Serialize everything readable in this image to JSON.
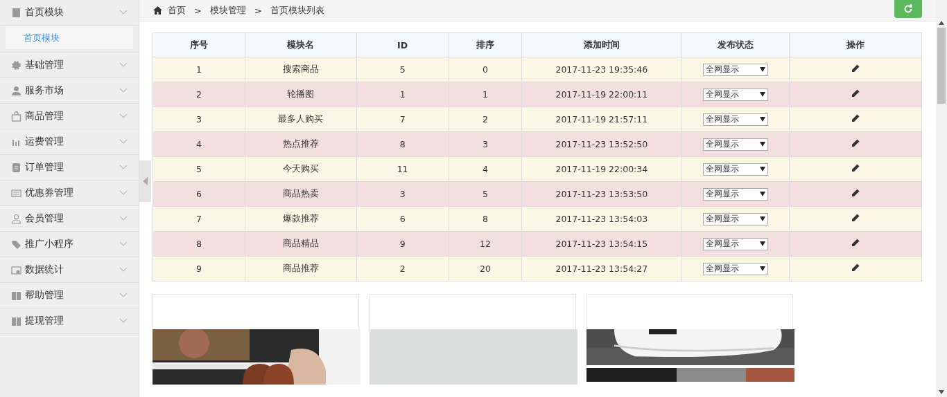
{
  "sidebar": {
    "items": [
      {
        "label": "首页模块",
        "children": [
          {
            "label": "首页模块",
            "selected": true
          }
        ]
      },
      {
        "label": "基础管理"
      },
      {
        "label": "服务市场"
      },
      {
        "label": "商品管理"
      },
      {
        "label": "运费管理"
      },
      {
        "label": "订单管理"
      },
      {
        "label": "优惠券管理"
      },
      {
        "label": "会员管理"
      },
      {
        "label": "推广小程序"
      },
      {
        "label": "数据统计"
      },
      {
        "label": "帮助管理"
      },
      {
        "label": "提现管理"
      }
    ]
  },
  "breadcrumb": [
    "首页",
    "模块管理",
    "首页模块列表"
  ],
  "breadcrumb_separator": ">",
  "table": {
    "columns": [
      "序号",
      "模块名",
      "ID",
      "排序",
      "添加时间",
      "发布状态",
      "操作"
    ],
    "rows": [
      {
        "cells": [
          "1",
          "搜索商品",
          "5",
          "0",
          "2017-11-23 19:35:46"
        ],
        "status": "全网显示"
      },
      {
        "cells": [
          "2",
          "轮播图",
          "1",
          "1",
          "2017-11-19 22:00:11"
        ],
        "status": "全网显示"
      },
      {
        "cells": [
          "3",
          "最多人购买",
          "7",
          "2",
          "2017-11-19 21:57:11"
        ],
        "status": "全网显示"
      },
      {
        "cells": [
          "4",
          "热点推荐",
          "8",
          "3",
          "2017-11-23 13:52:50"
        ],
        "status": "全网显示"
      },
      {
        "cells": [
          "5",
          "今天购买",
          "11",
          "4",
          "2017-11-19 22:00:34"
        ],
        "status": "全网显示"
      },
      {
        "cells": [
          "6",
          "商品热卖",
          "3",
          "5",
          "2017-11-23 13:53:50"
        ],
        "status": "全网显示"
      },
      {
        "cells": [
          "7",
          "爆款推荐",
          "6",
          "8",
          "2017-11-23 13:54:03"
        ],
        "status": "全网显示"
      },
      {
        "cells": [
          "8",
          "商品精品",
          "9",
          "12",
          "2017-11-23 13:54:15"
        ],
        "status": "全网显示"
      },
      {
        "cells": [
          "9",
          "商品推荐",
          "2",
          "20",
          "2017-11-23 13:54:27"
        ],
        "status": "全网显示"
      }
    ]
  },
  "cards": [
    {
      "pictures": [
        {
          "kind": "picture"
        }
      ]
    },
    {
      "pictures": [
        {
          "kind": "blank"
        }
      ]
    },
    {
      "pictures": [
        {
          "kind": "picture"
        },
        {
          "kind": "picture"
        }
      ]
    }
  ]
}
